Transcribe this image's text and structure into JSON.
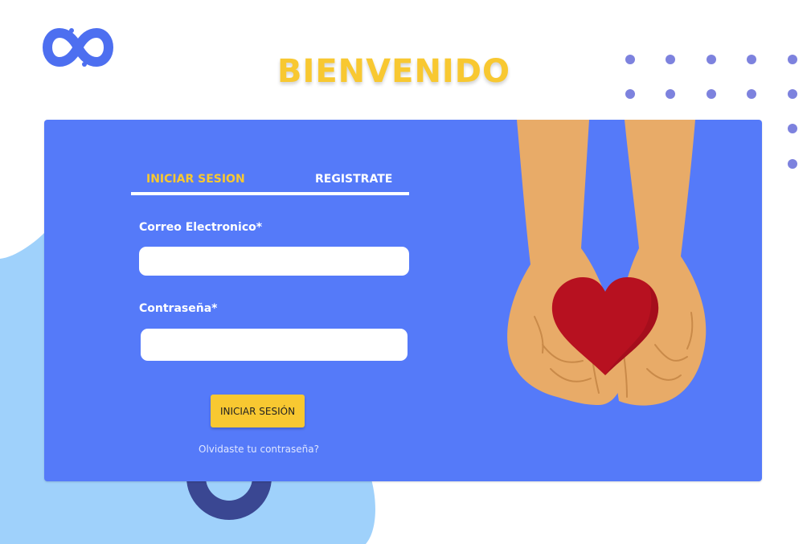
{
  "header": {
    "title": "BIENVENIDO"
  },
  "auth": {
    "tabs": [
      {
        "label": "INICIAR SESION",
        "active": true
      },
      {
        "label": "REGISTRATE",
        "active": false
      }
    ],
    "email": {
      "label": "Correo Electronico*",
      "value": "",
      "placeholder": ""
    },
    "password": {
      "label": "Contraseña*",
      "value": "",
      "placeholder": ""
    },
    "submit_label": "INICIAR SESIÓN",
    "forgot_label": "Olvidaste tu contraseña?"
  },
  "colors": {
    "card": "#557af9",
    "accent_yellow": "#f8c831",
    "logo_blue": "#4d6ff0",
    "dots": "#7d82de",
    "light_blob": "#9fd1fb",
    "ring": "#3a4792",
    "heart": "#b71120",
    "skin": "#e8ab68"
  },
  "icons": [
    "infinity-logo-icon",
    "heart-hands-illustration"
  ]
}
